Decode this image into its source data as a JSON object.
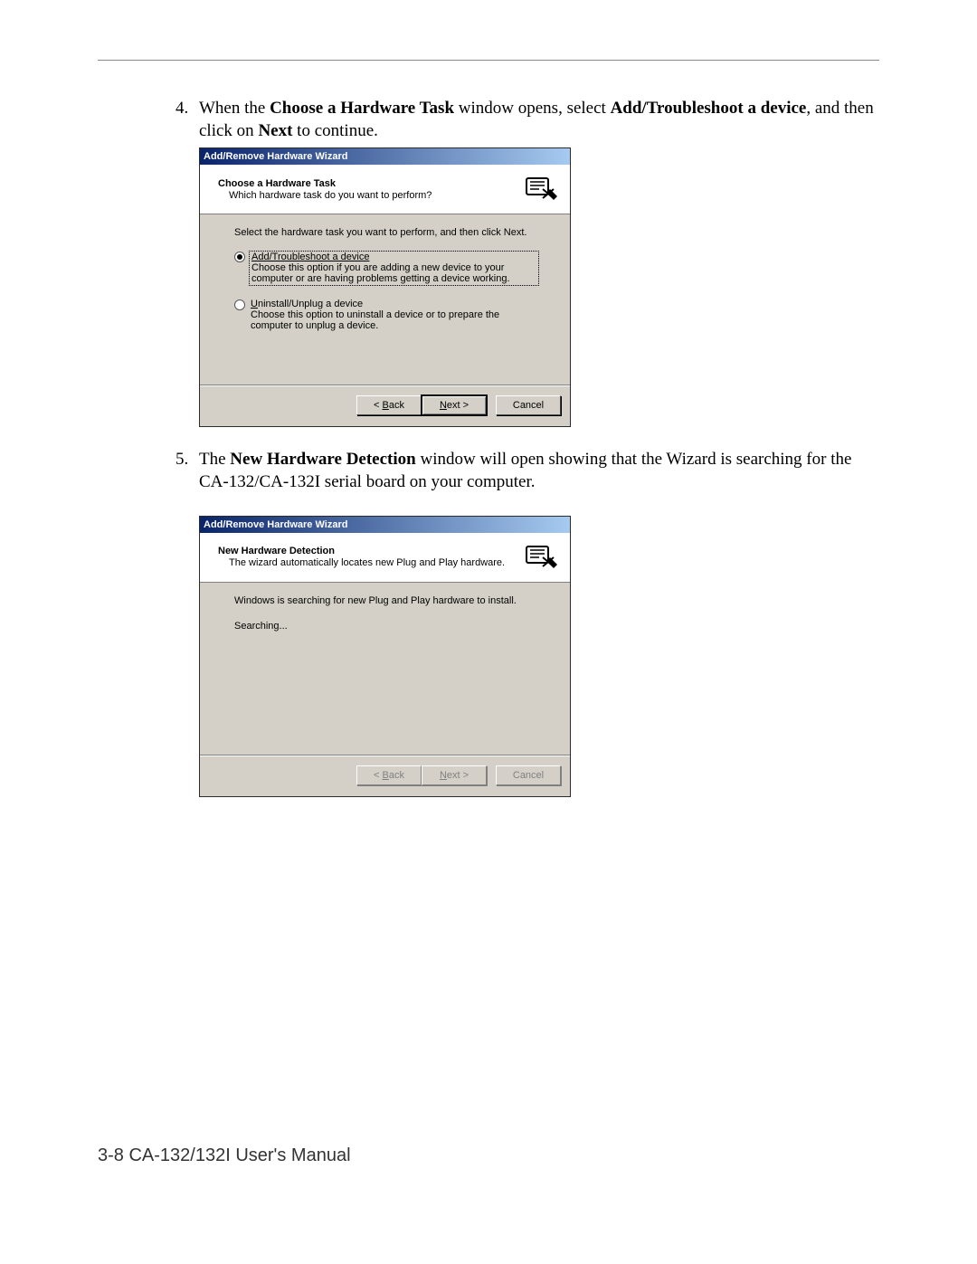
{
  "step4": {
    "num": "4.",
    "text_pre": "When the ",
    "bold1": "Choose a Hardware Task",
    "text_mid1": " window opens, select ",
    "bold2": "Add/Troubleshoot a device",
    "text_mid2": ", and then click on ",
    "bold3": "Next",
    "text_post": " to continue."
  },
  "wiz1": {
    "title": "Add/Remove Hardware Wizard",
    "head_title": "Choose a Hardware Task",
    "head_sub": "Which hardware task do you want to perform?",
    "instr": "Select the hardware task you want to perform, and then click Next.",
    "opt1_label": "Add/Troubleshoot a device",
    "opt1_desc": "Choose this option if you are adding a new device to your computer or are having problems getting a device working.",
    "opt2_label_pre": "",
    "opt2_label_u": "U",
    "opt2_label_rest": "ninstall/Unplug a device",
    "opt2_desc": "Choose this option to uninstall a device or to prepare the computer to unplug a device.",
    "back": "< Back",
    "next": "Next >",
    "cancel": "Cancel"
  },
  "step5": {
    "num": "5.",
    "text_pre": "The ",
    "bold1": "New Hardware Detection",
    "text_post": " window will open showing that the Wizard is searching for the CA-132/CA-132I serial board on your computer."
  },
  "wiz2": {
    "title": "Add/Remove Hardware Wizard",
    "head_title": "New Hardware Detection",
    "head_sub": "The wizard automatically locates new Plug and Play hardware.",
    "instr": "Windows is searching for new Plug and Play hardware to install.",
    "searching": "Searching...",
    "back": "< Back",
    "next": "Next >",
    "cancel": "Cancel"
  },
  "footer": "3-8  CA-132/132I User's Manual"
}
